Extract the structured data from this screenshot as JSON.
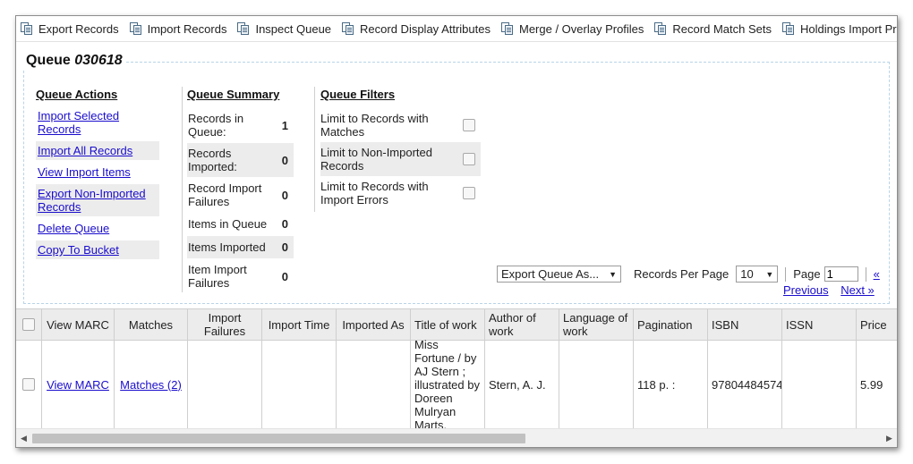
{
  "toolbar": {
    "buttons": [
      {
        "label": "Export Records",
        "icon": "copy-pages-icon"
      },
      {
        "label": "Import Records",
        "icon": "copy-pages-icon"
      },
      {
        "label": "Inspect Queue",
        "icon": "copy-pages-icon"
      },
      {
        "label": "Record Display Attributes",
        "icon": "copy-pages-icon"
      },
      {
        "label": "Merge / Overlay Profiles",
        "icon": "copy-pages-icon"
      },
      {
        "label": "Record Match Sets",
        "icon": "copy-pages-icon"
      },
      {
        "label": "Holdings Import Profiles",
        "icon": "copy-pages-icon"
      }
    ]
  },
  "queue": {
    "title_prefix": "Queue",
    "title_number": "030618"
  },
  "actions": {
    "heading": "Queue Actions",
    "items": [
      "Import Selected Records",
      "Import All Records",
      "View Import Items",
      "Export Non-Imported Records",
      "Delete Queue",
      "Copy To Bucket"
    ]
  },
  "summary": {
    "heading": "Queue Summary",
    "rows": [
      {
        "label": "Records in Queue:",
        "value": "1"
      },
      {
        "label": "Records Imported:",
        "value": "0"
      },
      {
        "label": "Record Import Failures",
        "value": "0"
      },
      {
        "label": "Items in Queue",
        "value": "0"
      },
      {
        "label": "Items Imported",
        "value": "0"
      },
      {
        "label": "Item Import Failures",
        "value": "0"
      }
    ]
  },
  "filters": {
    "heading": "Queue Filters",
    "rows": [
      {
        "label": "Limit to Records with Matches",
        "checked": false
      },
      {
        "label": "Limit to Non-Imported Records",
        "checked": false
      },
      {
        "label": "Limit to Records with Import Errors",
        "checked": false
      }
    ]
  },
  "pager": {
    "export_select": "Export Queue As...",
    "records_per_page_label": "Records Per Page",
    "records_per_page": "10",
    "page_label": "Page",
    "page_value": "1",
    "first": "«",
    "previous": "Previous",
    "next": "Next »"
  },
  "grid": {
    "headers": [
      "",
      "View MARC",
      "Matches",
      "Import Failures",
      "Import Time",
      "Imported As",
      "Title of work",
      "Author of work",
      "Language of work",
      "Pagination",
      "ISBN",
      "ISSN",
      "Price"
    ],
    "row": {
      "checked": false,
      "view_marc": "View MARC",
      "matches": "Matches (2)",
      "import_failures": "",
      "import_time": "",
      "imported_as": "",
      "title": "Miss Fortune / by AJ Stern ; illustrated by Doreen Mulryan Marts.",
      "author": "Stern, A. J.",
      "language": "",
      "pagination": "118 p. :",
      "isbn": "97804484574",
      "issn": "",
      "price": "5.99"
    }
  }
}
